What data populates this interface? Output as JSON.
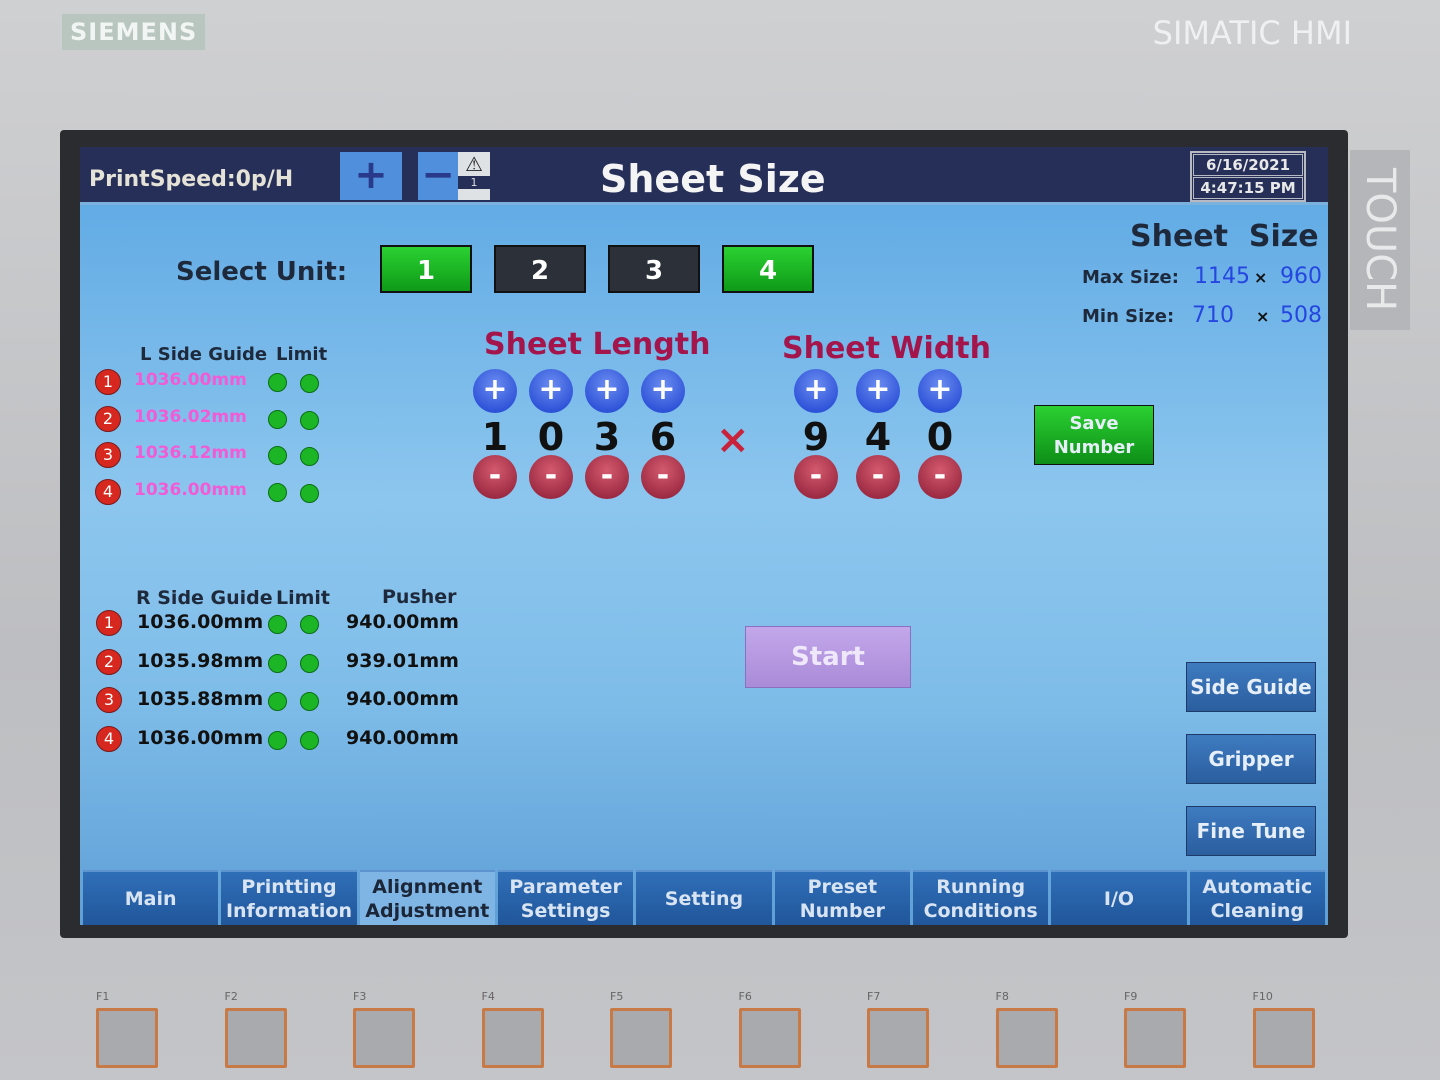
{
  "device": {
    "brand": "SIEMENS",
    "model": "SIMATIC HMI",
    "side_label": "TOUCH",
    "fkeys": [
      "F1",
      "F2",
      "F3",
      "F4",
      "F5",
      "F6",
      "F7",
      "F8",
      "F9",
      "F10"
    ]
  },
  "header": {
    "print_speed": "PrintSpeed:0p/H",
    "plus": "+",
    "minus": "−",
    "alarm_count": "1",
    "title": "Sheet Size",
    "date": "6/16/2021",
    "time": "4:47:15 PM"
  },
  "select_unit": {
    "label": "Select Unit:",
    "units": [
      {
        "label": "1",
        "active": true
      },
      {
        "label": "2",
        "active": false
      },
      {
        "label": "3",
        "active": false
      },
      {
        "label": "4",
        "active": true
      }
    ]
  },
  "sheet_size": {
    "title": "Sheet  Size",
    "max_label": "Max Size:",
    "max_length": "1145",
    "max_width": "960",
    "min_label": "Min Size:",
    "min_length": "710",
    "min_width": "508",
    "times": "×"
  },
  "sheet_length": {
    "label": "Sheet Length",
    "digits": [
      "1",
      "0",
      "3",
      "6"
    ]
  },
  "sheet_width": {
    "label": "Sheet Width",
    "digits": [
      "9",
      "4",
      "0"
    ]
  },
  "multiply": "×",
  "save_button": "Save Number",
  "l_side": {
    "header": "L Side Guide",
    "limit_header": "Limit",
    "rows": [
      {
        "n": "1",
        "value": "1036.00mm"
      },
      {
        "n": "2",
        "value": "1036.02mm"
      },
      {
        "n": "3",
        "value": "1036.12mm"
      },
      {
        "n": "4",
        "value": "1036.00mm"
      }
    ]
  },
  "r_side": {
    "header": "R Side Guide",
    "limit_header": "Limit",
    "pusher_header": "Pusher",
    "rows": [
      {
        "n": "1",
        "value": "1036.00mm",
        "pusher": "940.00mm"
      },
      {
        "n": "2",
        "value": "1035.98mm",
        "pusher": "939.01mm"
      },
      {
        "n": "3",
        "value": "1035.88mm",
        "pusher": "940.00mm"
      },
      {
        "n": "4",
        "value": "1036.00mm",
        "pusher": "940.00mm"
      }
    ]
  },
  "start_button": "Start",
  "side_buttons": [
    "Side Guide",
    "Gripper",
    "Fine Tune"
  ],
  "tabs": [
    {
      "label": "Main"
    },
    {
      "label": "Printting Information"
    },
    {
      "label": "Alignment Adjustment",
      "active": true
    },
    {
      "label": "Parameter Settings"
    },
    {
      "label": "Setting"
    },
    {
      "label": "Preset Number"
    },
    {
      "label": "Running Conditions"
    },
    {
      "label": "I/O"
    },
    {
      "label": "Automatic Cleaning"
    }
  ],
  "colors": {
    "active_unit": "#1ec427",
    "header": "#252f58",
    "led": "#1bb526",
    "l_value": "#f25bd6"
  }
}
